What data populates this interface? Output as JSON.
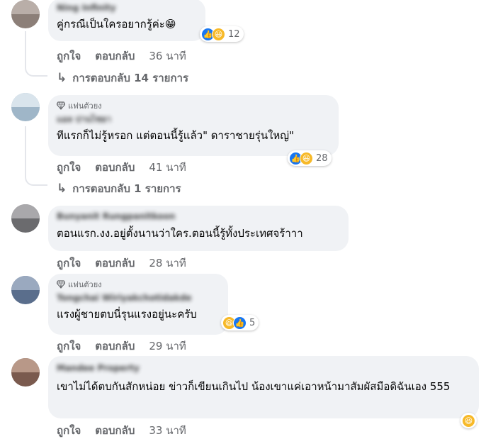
{
  "comments": [
    {
      "text": "คู่กรณีเป็นใครอยากรู้ค่ะ😁",
      "author": "Ning Infinity",
      "reaction_count": "12",
      "like_label": "ถูกใจ",
      "reply_label": "ตอบกลับ",
      "time": "36 นาที",
      "replies_link": "การตอบกลับ 14 รายการ"
    },
    {
      "badge": "แฟนตัวยง",
      "author": "แอล ปานไชยา",
      "text": "ทีแรกก็ไม่รู้หรอก แต่ตอนนี้รู้แล้ว\" ดาราชายรุ่นใหญ่\"",
      "reaction_count": "28",
      "like_label": "ถูกใจ",
      "reply_label": "ตอบกลับ",
      "time": "41 นาที",
      "replies_link": "การตอบกลับ 1 รายการ"
    },
    {
      "author": "Bunyanit Rungpanitkoon",
      "text": "ตอนแรก.งง.อยู่ตั้งนานว่าใคร.ตอนนี้รู้ทั้งประเทศจร้าาา",
      "like_label": "ถูกใจ",
      "reply_label": "ตอบกลับ",
      "time": "28 นาที"
    },
    {
      "badge": "แฟนตัวยง",
      "author": "Tongchai Wiriyakchotidakde",
      "text": "แรงผู้ชายตบนี่รุนแรงอยู่นะครับ",
      "reaction_count": "5",
      "like_label": "ถูกใจ",
      "reply_label": "ตอบกลับ",
      "time": "29 นาที"
    },
    {
      "author": "Mandee Property",
      "text": "เขาไม่ได้ตบกันสักหน่อย ข่าวก็เขียนเกินไป น้องเขาแค่เอาหน้ามาสัมผัสมือดิฉันเอง 555",
      "like_label": "ถูกใจ",
      "reply_label": "ตอบกลับ",
      "time": "33 นาที"
    }
  ],
  "colors": {
    "bubble": "#f0f2f5",
    "secondary_text": "#65676b",
    "like_blue": "#1877f2",
    "haha_yellow": "#f7b928",
    "thread_line": "#e4e6eb"
  },
  "icons": [
    "like-icon",
    "haha-icon",
    "diamond-icon",
    "reply-arrow-icon"
  ]
}
